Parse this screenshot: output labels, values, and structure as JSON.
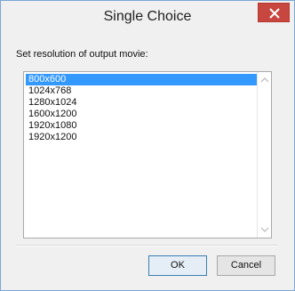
{
  "dialog": {
    "title": "Single Choice",
    "prompt": "Set resolution of output movie:"
  },
  "options": [
    {
      "label": "800x600",
      "selected": true
    },
    {
      "label": "1024x768",
      "selected": false
    },
    {
      "label": "1280x1024",
      "selected": false
    },
    {
      "label": "1600x1200",
      "selected": false
    },
    {
      "label": "1920x1080",
      "selected": false
    },
    {
      "label": "1920x1200",
      "selected": false
    }
  ],
  "buttons": {
    "ok": "OK",
    "cancel": "Cancel"
  },
  "colors": {
    "close_button": "#c7463f",
    "selection": "#3399ff",
    "border_accent": "#7aa7d6"
  },
  "icons": {
    "close": "close-icon",
    "scroll_up": "chevron-up-icon",
    "scroll_down": "chevron-down-icon"
  }
}
